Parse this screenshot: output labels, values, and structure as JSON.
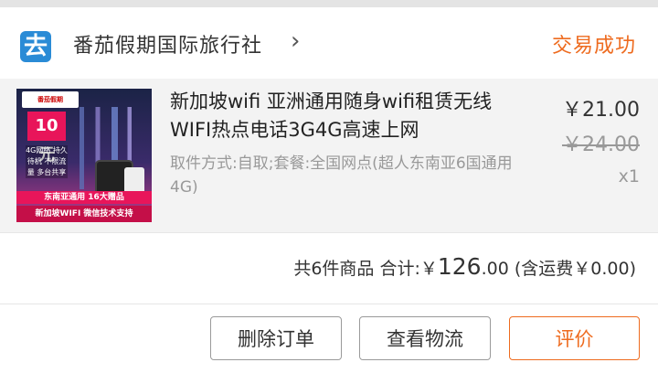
{
  "shop": {
    "logo_char": "去",
    "name": "番茄假期国际旅行社",
    "chevron": "›",
    "status": "交易成功"
  },
  "item": {
    "thumbnail": {
      "logo_text": "番茄假期",
      "price_badge": "10元",
      "features": "4G网络 持久待机 不限流量 多台共享",
      "banner_top": "东南亚通用 16大赠品",
      "banner_bottom": "新加坡WIFI 微信技术支持"
    },
    "title": "新加坡wifi 亚洲通用随身wifi租赁无线WIFI热点电话3G4G高速上网",
    "spec": "取件方式:自取;套餐:全国网点(超人东南亚6国通用4G)",
    "price": "￥21.00",
    "original_price": "￥24.00",
    "quantity": "x1"
  },
  "summary": {
    "count_text": "共6件商品",
    "total_label": "合计:",
    "currency": "￥",
    "total_int": "126",
    "total_dec": ".00",
    "shipping_text": "(含运费￥0.00)"
  },
  "actions": {
    "delete_label": "删除订单",
    "logistics_label": "查看物流",
    "review_label": "评价"
  },
  "colors": {
    "accent": "#ee6b1f",
    "shop_logo": "#2a8bd6"
  }
}
